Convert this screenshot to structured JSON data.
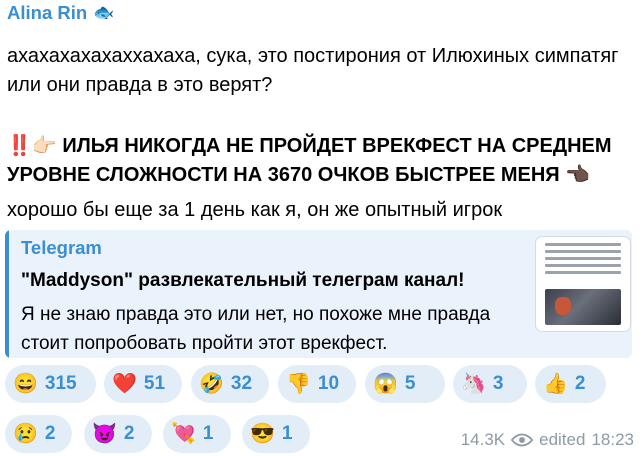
{
  "author": {
    "name": "Alina Rin",
    "emoji": "🐟"
  },
  "body": {
    "para1": "ахахахахахаххахаха, сука, это постирония от Илюхиных симпатяг или они правда в это верят?",
    "para2_prefix_emoji": "‼️👉🏻",
    "para2_text": "ИЛЬЯ НИКОГДА НЕ ПРОЙДЕТ ВРЕКФЕСТ НА СРЕДНЕМ УРОВНЕ СЛОЖНОСТИ НА 3670 ОЧКОВ БЫСТРЕЕ МЕНЯ",
    "para2_suffix_emoji": "👈🏿",
    "para3": "хорошо бы еще за 1 день как я, он же опытный игрок"
  },
  "link_preview": {
    "site": "Telegram",
    "title": "\"Maddyson\" развлекательный телеграм канал!",
    "description": "Я не знаю правда это или нет, но похоже мне правда стоит попробовать пройти этот врекфест.",
    "accent_color": "#3a8fd0"
  },
  "reactions": [
    {
      "emoji": "😄",
      "count": "315"
    },
    {
      "emoji": "❤️",
      "count": "51"
    },
    {
      "emoji": "🤣",
      "count": "32"
    },
    {
      "emoji": "👎",
      "count": "10"
    },
    {
      "emoji": "😱",
      "count": "5"
    },
    {
      "emoji": "🦄",
      "count": "3"
    },
    {
      "emoji": "👍",
      "count": "2"
    },
    {
      "emoji": "😢",
      "count": "2"
    },
    {
      "emoji": "😈",
      "count": "2"
    },
    {
      "emoji": "💘",
      "count": "1"
    },
    {
      "emoji": "😎",
      "count": "1"
    }
  ],
  "meta": {
    "views": "14.3K",
    "eye_icon": "eye-icon",
    "edited_label": "edited",
    "time": "18:23"
  }
}
